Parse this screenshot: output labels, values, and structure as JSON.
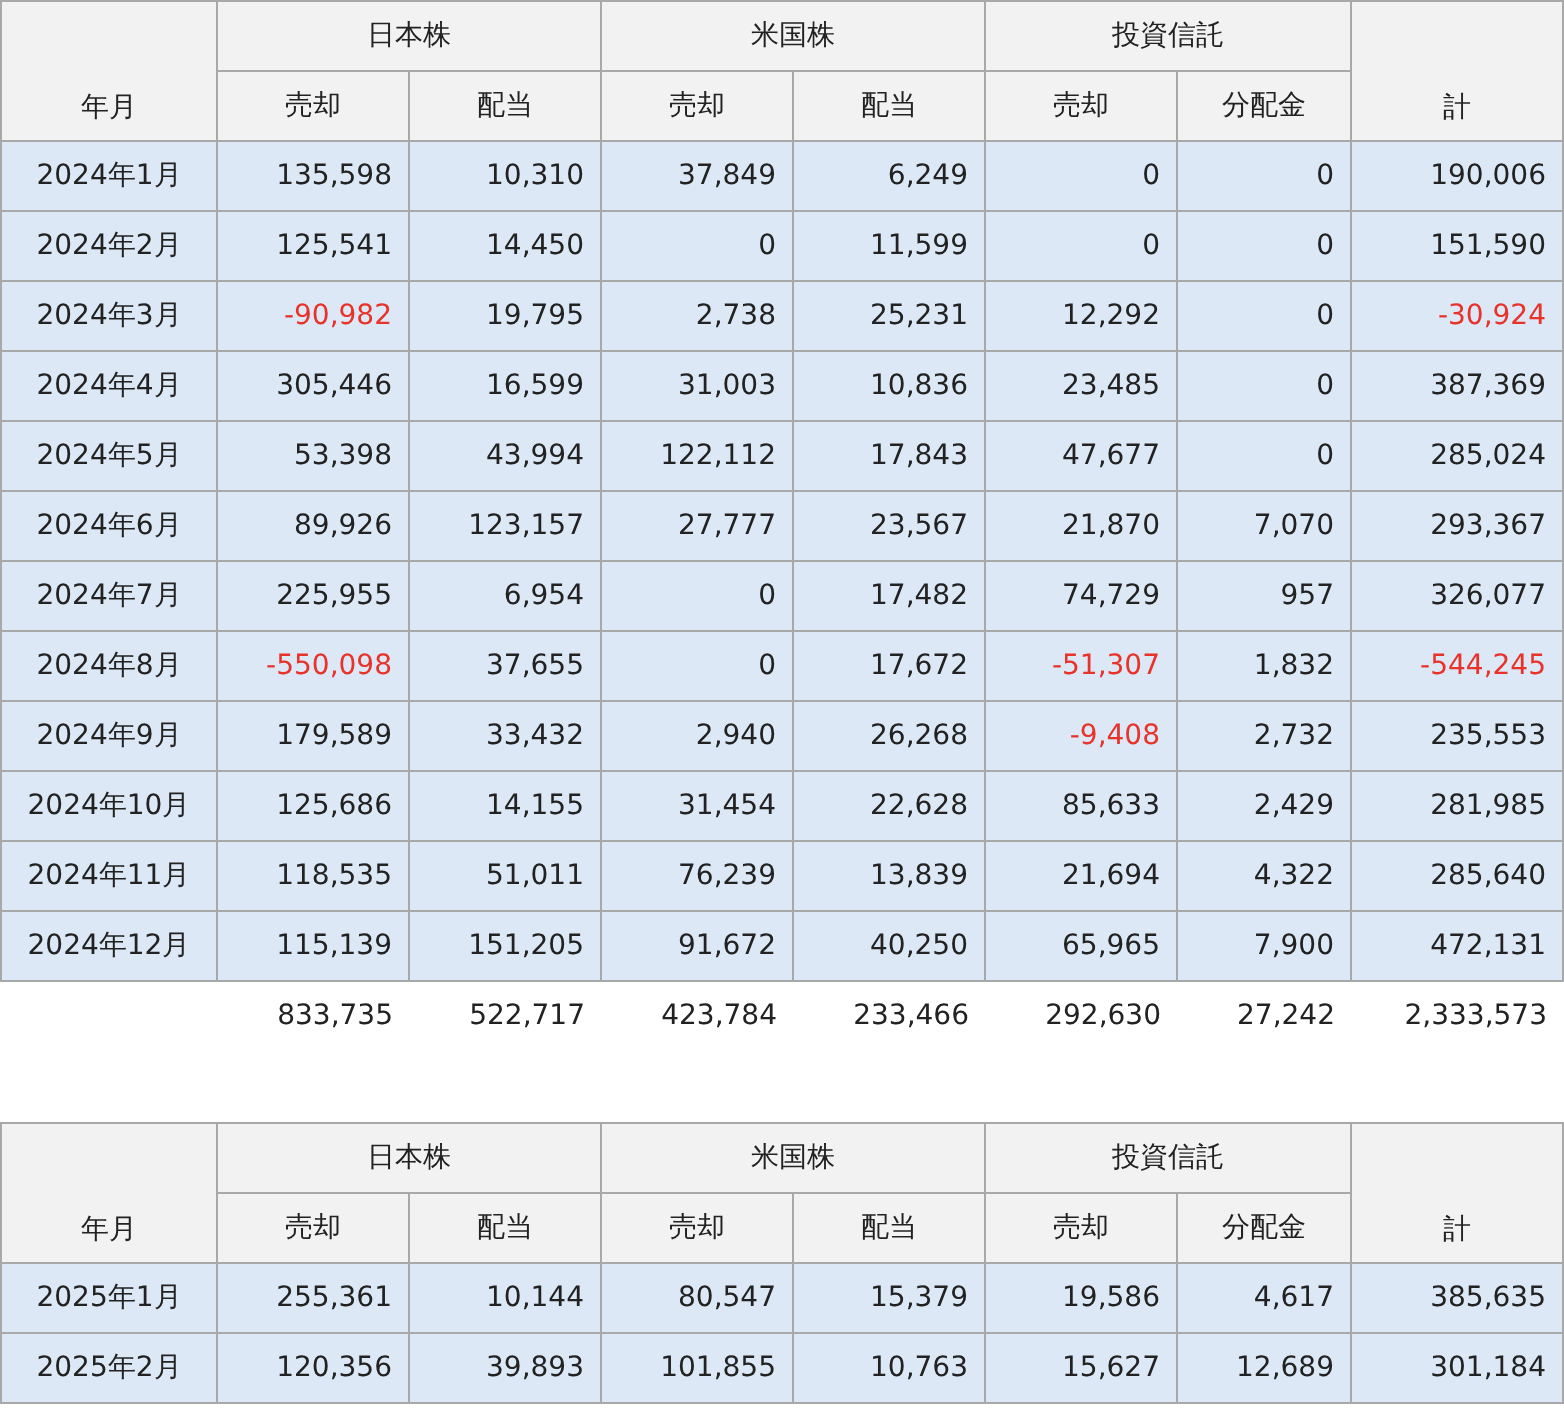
{
  "tables": [
    {
      "month_header": "年月",
      "total_header": "計",
      "groups": [
        {
          "label": "日本株",
          "columns": [
            "売却",
            "配当"
          ]
        },
        {
          "label": "米国株",
          "columns": [
            "売却",
            "配当"
          ]
        },
        {
          "label": "投資信託",
          "columns": [
            "売却",
            "分配金"
          ]
        }
      ],
      "rows": [
        {
          "month": "2024年1月",
          "cells": [
            {
              "text": "135,598",
              "negative": false
            },
            {
              "text": "10,310",
              "negative": false
            },
            {
              "text": "37,849",
              "negative": false
            },
            {
              "text": "6,249",
              "negative": false
            },
            {
              "text": "0",
              "negative": false
            },
            {
              "text": "0",
              "negative": false
            },
            {
              "text": "190,006",
              "negative": false
            }
          ]
        },
        {
          "month": "2024年2月",
          "cells": [
            {
              "text": "125,541",
              "negative": false
            },
            {
              "text": "14,450",
              "negative": false
            },
            {
              "text": "0",
              "negative": false
            },
            {
              "text": "11,599",
              "negative": false
            },
            {
              "text": "0",
              "negative": false
            },
            {
              "text": "0",
              "negative": false
            },
            {
              "text": "151,590",
              "negative": false
            }
          ]
        },
        {
          "month": "2024年3月",
          "cells": [
            {
              "text": "-90,982",
              "negative": true
            },
            {
              "text": "19,795",
              "negative": false
            },
            {
              "text": "2,738",
              "negative": false
            },
            {
              "text": "25,231",
              "negative": false
            },
            {
              "text": "12,292",
              "negative": false
            },
            {
              "text": "0",
              "negative": false
            },
            {
              "text": "-30,924",
              "negative": true
            }
          ]
        },
        {
          "month": "2024年4月",
          "cells": [
            {
              "text": "305,446",
              "negative": false
            },
            {
              "text": "16,599",
              "negative": false
            },
            {
              "text": "31,003",
              "negative": false
            },
            {
              "text": "10,836",
              "negative": false
            },
            {
              "text": "23,485",
              "negative": false
            },
            {
              "text": "0",
              "negative": false
            },
            {
              "text": "387,369",
              "negative": false
            }
          ]
        },
        {
          "month": "2024年5月",
          "cells": [
            {
              "text": "53,398",
              "negative": false
            },
            {
              "text": "43,994",
              "negative": false
            },
            {
              "text": "122,112",
              "negative": false
            },
            {
              "text": "17,843",
              "negative": false
            },
            {
              "text": "47,677",
              "negative": false
            },
            {
              "text": "0",
              "negative": false
            },
            {
              "text": "285,024",
              "negative": false
            }
          ]
        },
        {
          "month": "2024年6月",
          "cells": [
            {
              "text": "89,926",
              "negative": false
            },
            {
              "text": "123,157",
              "negative": false
            },
            {
              "text": "27,777",
              "negative": false
            },
            {
              "text": "23,567",
              "negative": false
            },
            {
              "text": "21,870",
              "negative": false
            },
            {
              "text": "7,070",
              "negative": false
            },
            {
              "text": "293,367",
              "negative": false
            }
          ]
        },
        {
          "month": "2024年7月",
          "cells": [
            {
              "text": "225,955",
              "negative": false
            },
            {
              "text": "6,954",
              "negative": false
            },
            {
              "text": "0",
              "negative": false
            },
            {
              "text": "17,482",
              "negative": false
            },
            {
              "text": "74,729",
              "negative": false
            },
            {
              "text": "957",
              "negative": false
            },
            {
              "text": "326,077",
              "negative": false
            }
          ]
        },
        {
          "month": "2024年8月",
          "cells": [
            {
              "text": "-550,098",
              "negative": true
            },
            {
              "text": "37,655",
              "negative": false
            },
            {
              "text": "0",
              "negative": false
            },
            {
              "text": "17,672",
              "negative": false
            },
            {
              "text": "-51,307",
              "negative": true
            },
            {
              "text": "1,832",
              "negative": false
            },
            {
              "text": "-544,245",
              "negative": true
            }
          ]
        },
        {
          "month": "2024年9月",
          "cells": [
            {
              "text": "179,589",
              "negative": false
            },
            {
              "text": "33,432",
              "negative": false
            },
            {
              "text": "2,940",
              "negative": false
            },
            {
              "text": "26,268",
              "negative": false
            },
            {
              "text": "-9,408",
              "negative": true
            },
            {
              "text": "2,732",
              "negative": false
            },
            {
              "text": "235,553",
              "negative": false
            }
          ]
        },
        {
          "month": "2024年10月",
          "cells": [
            {
              "text": "125,686",
              "negative": false
            },
            {
              "text": "14,155",
              "negative": false
            },
            {
              "text": "31,454",
              "negative": false
            },
            {
              "text": "22,628",
              "negative": false
            },
            {
              "text": "85,633",
              "negative": false
            },
            {
              "text": "2,429",
              "negative": false
            },
            {
              "text": "281,985",
              "negative": false
            }
          ]
        },
        {
          "month": "2024年11月",
          "cells": [
            {
              "text": "118,535",
              "negative": false
            },
            {
              "text": "51,011",
              "negative": false
            },
            {
              "text": "76,239",
              "negative": false
            },
            {
              "text": "13,839",
              "negative": false
            },
            {
              "text": "21,694",
              "negative": false
            },
            {
              "text": "4,322",
              "negative": false
            },
            {
              "text": "285,640",
              "negative": false
            }
          ]
        },
        {
          "month": "2024年12月",
          "cells": [
            {
              "text": "115,139",
              "negative": false
            },
            {
              "text": "151,205",
              "negative": false
            },
            {
              "text": "91,672",
              "negative": false
            },
            {
              "text": "40,250",
              "negative": false
            },
            {
              "text": "65,965",
              "negative": false
            },
            {
              "text": "7,900",
              "negative": false
            },
            {
              "text": "472,131",
              "negative": false
            }
          ]
        }
      ],
      "totals": [
        "833,735",
        "522,717",
        "423,784",
        "233,466",
        "292,630",
        "27,242",
        "2,333,573"
      ]
    },
    {
      "month_header": "年月",
      "total_header": "計",
      "groups": [
        {
          "label": "日本株",
          "columns": [
            "売却",
            "配当"
          ]
        },
        {
          "label": "米国株",
          "columns": [
            "売却",
            "配当"
          ]
        },
        {
          "label": "投資信託",
          "columns": [
            "売却",
            "分配金"
          ]
        }
      ],
      "rows": [
        {
          "month": "2025年1月",
          "cells": [
            {
              "text": "255,361",
              "negative": false
            },
            {
              "text": "10,144",
              "negative": false
            },
            {
              "text": "80,547",
              "negative": false
            },
            {
              "text": "15,379",
              "negative": false
            },
            {
              "text": "19,586",
              "negative": false
            },
            {
              "text": "4,617",
              "negative": false
            },
            {
              "text": "385,635",
              "negative": false
            }
          ]
        },
        {
          "month": "2025年2月",
          "cells": [
            {
              "text": "120,356",
              "negative": false
            },
            {
              "text": "39,893",
              "negative": false
            },
            {
              "text": "101,855",
              "negative": false
            },
            {
              "text": "10,763",
              "negative": false
            },
            {
              "text": "15,627",
              "negative": false
            },
            {
              "text": "12,689",
              "negative": false
            },
            {
              "text": "301,184",
              "negative": false
            }
          ]
        }
      ]
    }
  ]
}
